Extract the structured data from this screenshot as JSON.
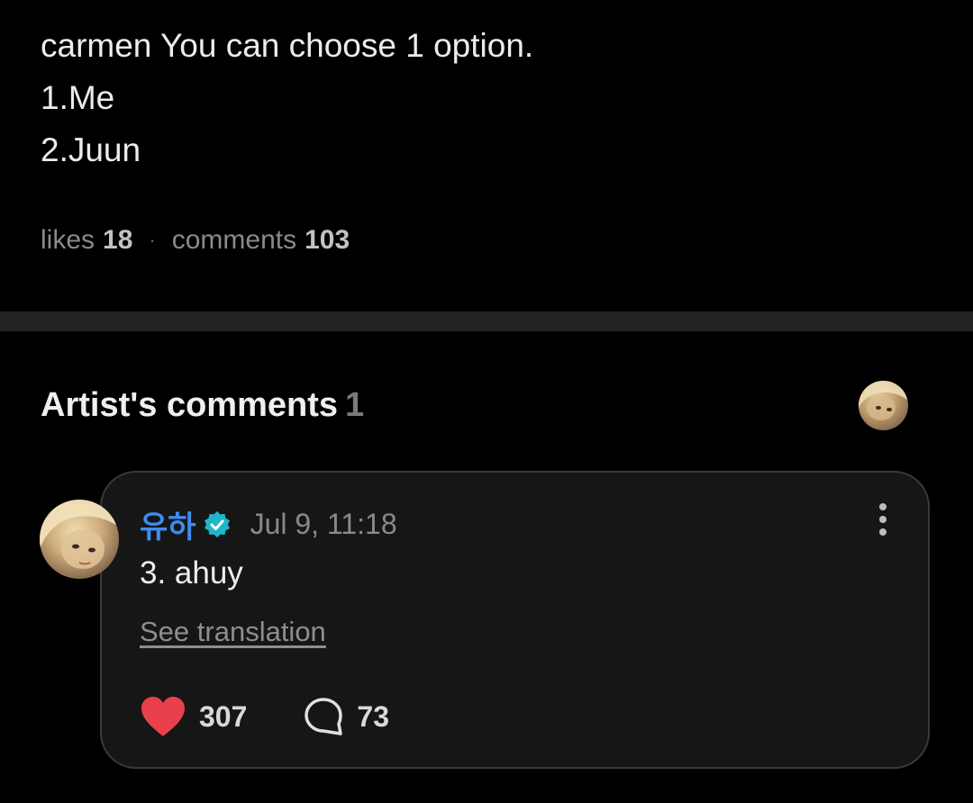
{
  "post": {
    "lines": [
      "carmen You can choose 1 option.",
      "1.Me",
      "2.Juun"
    ],
    "stats": {
      "likes_label": "likes",
      "likes_count": "18",
      "separator": "·",
      "comments_label": "comments",
      "comments_count": "103"
    }
  },
  "artist_comments": {
    "title": "Artist's comments",
    "count": "1"
  },
  "comment": {
    "author": "유하",
    "time": "Jul 9, 11:18",
    "text": "3. ahuy",
    "translate_label": "See translation",
    "likes": "307",
    "replies": "73"
  },
  "colors": {
    "background": "#000000",
    "divider": "#232323",
    "card_background": "#161616",
    "author_blue": "#3d8cf0",
    "verified_teal": "#1fb6c9",
    "heart_red": "#e8414b"
  },
  "icons": {
    "verified": "verified-badge-icon",
    "more": "more-vertical-icon",
    "like": "heart-icon",
    "reply": "comment-bubble-icon"
  }
}
